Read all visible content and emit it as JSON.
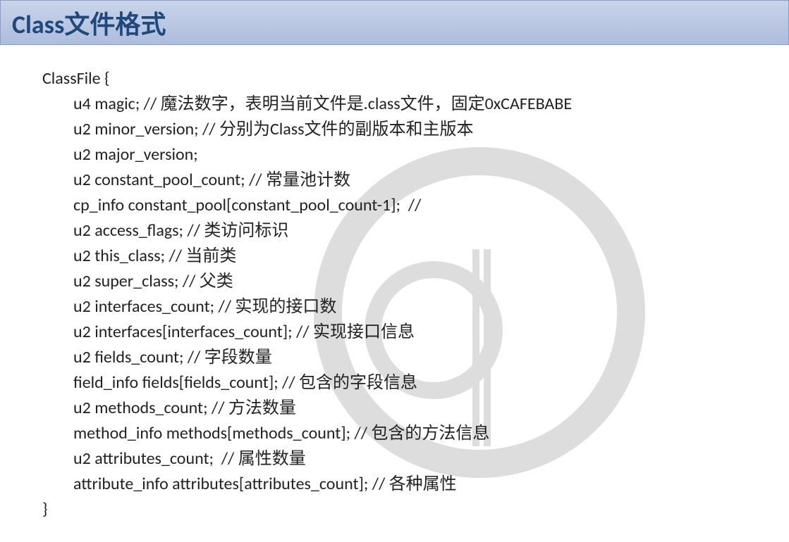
{
  "header": {
    "title": "Class文件格式"
  },
  "code": {
    "start": "ClassFile {",
    "lines": [
      "u4 magic; // 魔法数字，表明当前文件是.class文件，固定0xCAFEBABE",
      "u2 minor_version; // 分别为Class文件的副版本和主版本",
      "u2 major_version;",
      "u2 constant_pool_count; // 常量池计数",
      "cp_info constant_pool[constant_pool_count-1];  //",
      "u2 access_flags; // 类访问标识",
      "u2 this_class; // 当前类",
      "u2 super_class; // 父类",
      "u2 interfaces_count; // 实现的接口数",
      "u2 interfaces[interfaces_count]; // 实现接口信息",
      "u2 fields_count; // 字段数量",
      "field_info fields[fields_count]; // 包含的字段信息",
      "u2 methods_count; // 方法数量",
      "method_info methods[methods_count]; // 包含的方法信息",
      "u2 attributes_count;  // 属性数量",
      "attribute_info attributes[attributes_count]; // 各种属性"
    ],
    "end": "}"
  }
}
